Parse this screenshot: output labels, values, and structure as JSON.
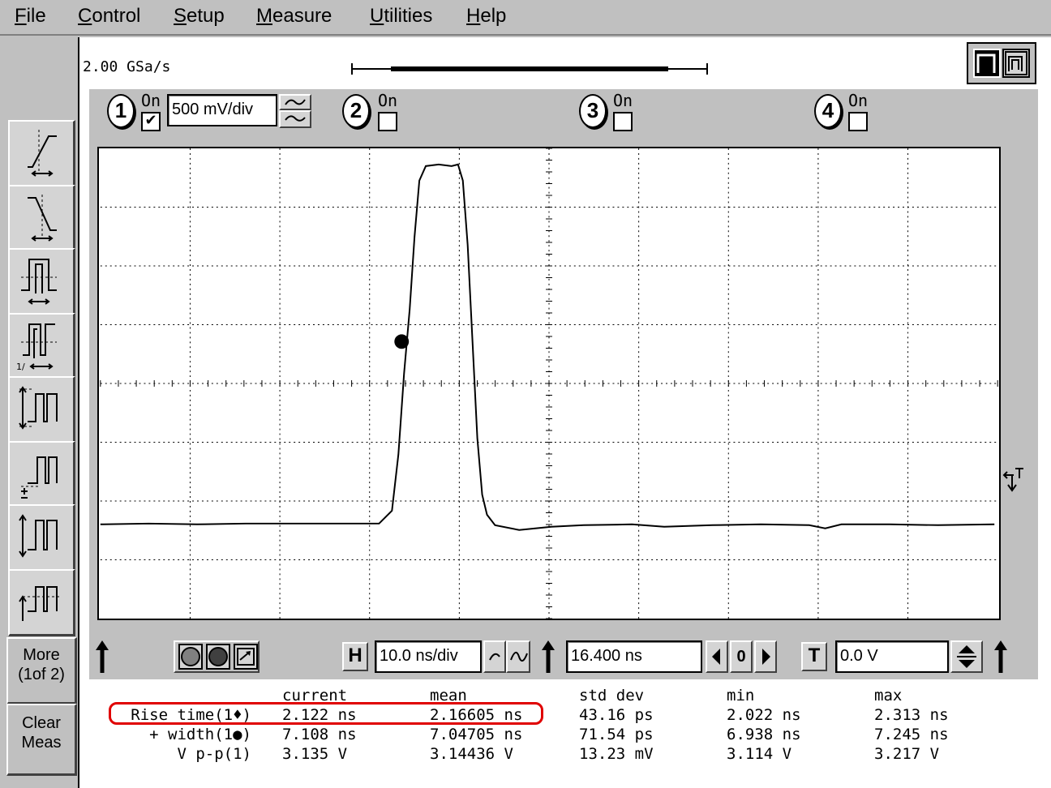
{
  "menu": [
    {
      "label": "File",
      "accel": "F",
      "rest": "ile"
    },
    {
      "label": "Control",
      "accel": "C",
      "rest": "ontrol"
    },
    {
      "label": "Setup",
      "accel": "S",
      "rest": "etup"
    },
    {
      "label": "Measure",
      "accel": "M",
      "rest": "easure"
    },
    {
      "label": "Utilities",
      "accel": "U",
      "rest": "tilities"
    },
    {
      "label": "Help",
      "accel": "H",
      "rest": "elp"
    }
  ],
  "acquisition": {
    "sample_rate": "2.00 GSa/s"
  },
  "channels": [
    {
      "number": "1",
      "on_label": "On",
      "enabled": true,
      "scale": "500 mV/div"
    },
    {
      "number": "2",
      "on_label": "On",
      "enabled": false
    },
    {
      "number": "3",
      "on_label": "On",
      "enabled": false
    },
    {
      "number": "4",
      "on_label": "On",
      "enabled": false
    }
  ],
  "left_panel": {
    "tools": [
      "rise-time-icon",
      "fall-time-icon",
      "plus-width-icon",
      "period-icon",
      "vpp-icon",
      "vbase-icon",
      "vamp-icon",
      "vtop-icon"
    ],
    "more_label_1": "More",
    "more_label_2": "(1of 2)",
    "clear_label_1": "Clear",
    "clear_label_2": "Meas"
  },
  "timebase": {
    "h_label": "H",
    "scale": "10.0 ns/div",
    "position": "16.400 ns",
    "zero_label": "0"
  },
  "trigger": {
    "t_label": "T",
    "level": "0.0 V"
  },
  "measurements": {
    "headers": {
      "current": "current",
      "mean": "mean",
      "std_dev": "std dev",
      "min": "min",
      "max": "max"
    },
    "rows": [
      {
        "name": "Rise time(1♦)",
        "current": "2.122 ns",
        "mean": "2.16605 ns",
        "std_dev": "43.16 ps",
        "min": "2.022 ns",
        "max": "2.313 ns",
        "highlighted": true
      },
      {
        "name": "+ width(1●)",
        "current": "7.108 ns",
        "mean": "7.04705 ns",
        "std_dev": "71.54 ps",
        "min": "6.938 ns",
        "max": "7.245 ns"
      },
      {
        "name": "V p-p(1)",
        "current": "3.135 V",
        "mean": "3.14436 V",
        "std_dev": "13.23 mV",
        "min": "3.114 V",
        "max": "3.217 V"
      }
    ]
  },
  "colors": {
    "background": "#c0c0c0",
    "highlight": "#e00000",
    "trace": "#000000"
  }
}
